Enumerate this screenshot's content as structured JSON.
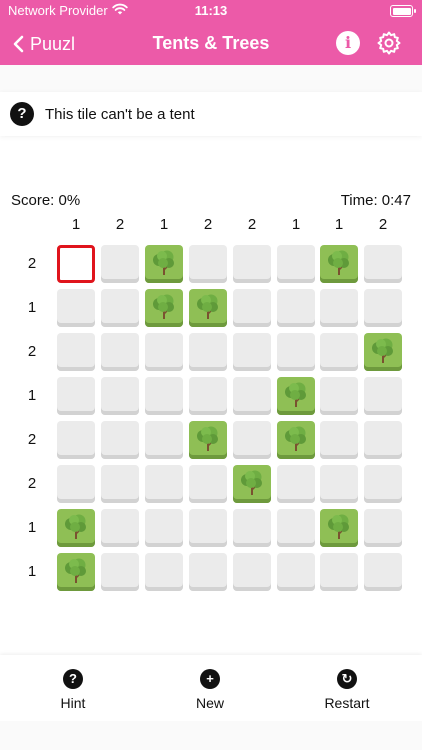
{
  "status_bar": {
    "carrier": "Network Provider",
    "time": "11:13"
  },
  "nav": {
    "back_label": "Puuzl",
    "title": "Tents & Trees"
  },
  "hint_message": "This tile can't be a tent",
  "stats": {
    "score": "Score: 0%",
    "time": "Time: 0:47"
  },
  "column_hints": [
    "1",
    "2",
    "1",
    "2",
    "2",
    "1",
    "1",
    "2"
  ],
  "row_hints": [
    "2",
    "1",
    "2",
    "1",
    "2",
    "2",
    "1",
    "1"
  ],
  "grid": {
    "selected_cell": [
      0,
      0
    ],
    "rows": [
      [
        ".",
        ".",
        "T",
        ".",
        ".",
        ".",
        "T",
        "."
      ],
      [
        ".",
        ".",
        "T",
        "T",
        ".",
        ".",
        ".",
        "."
      ],
      [
        ".",
        ".",
        ".",
        ".",
        ".",
        ".",
        ".",
        "T"
      ],
      [
        ".",
        ".",
        ".",
        ".",
        ".",
        "T",
        ".",
        "."
      ],
      [
        ".",
        ".",
        ".",
        "T",
        ".",
        "T",
        ".",
        "."
      ],
      [
        ".",
        ".",
        ".",
        ".",
        "T",
        ".",
        ".",
        "."
      ],
      [
        "T",
        ".",
        ".",
        ".",
        ".",
        ".",
        "T",
        "."
      ],
      [
        "T",
        ".",
        ".",
        ".",
        ".",
        ".",
        ".",
        "."
      ]
    ]
  },
  "toolbar": {
    "hint_label": "Hint",
    "new_label": "New",
    "restart_label": "Restart"
  },
  "colors": {
    "header": "#ec5aa8",
    "tree_tile": "#8fbf55",
    "empty_tile": "#ebebeb",
    "selected_border": "#e0141c"
  },
  "icons": [
    "back-chevron-icon",
    "info-icon",
    "gear-icon",
    "question-icon",
    "tree-icon",
    "plus-icon",
    "restart-icon",
    "wifi-icon",
    "battery-icon"
  ]
}
